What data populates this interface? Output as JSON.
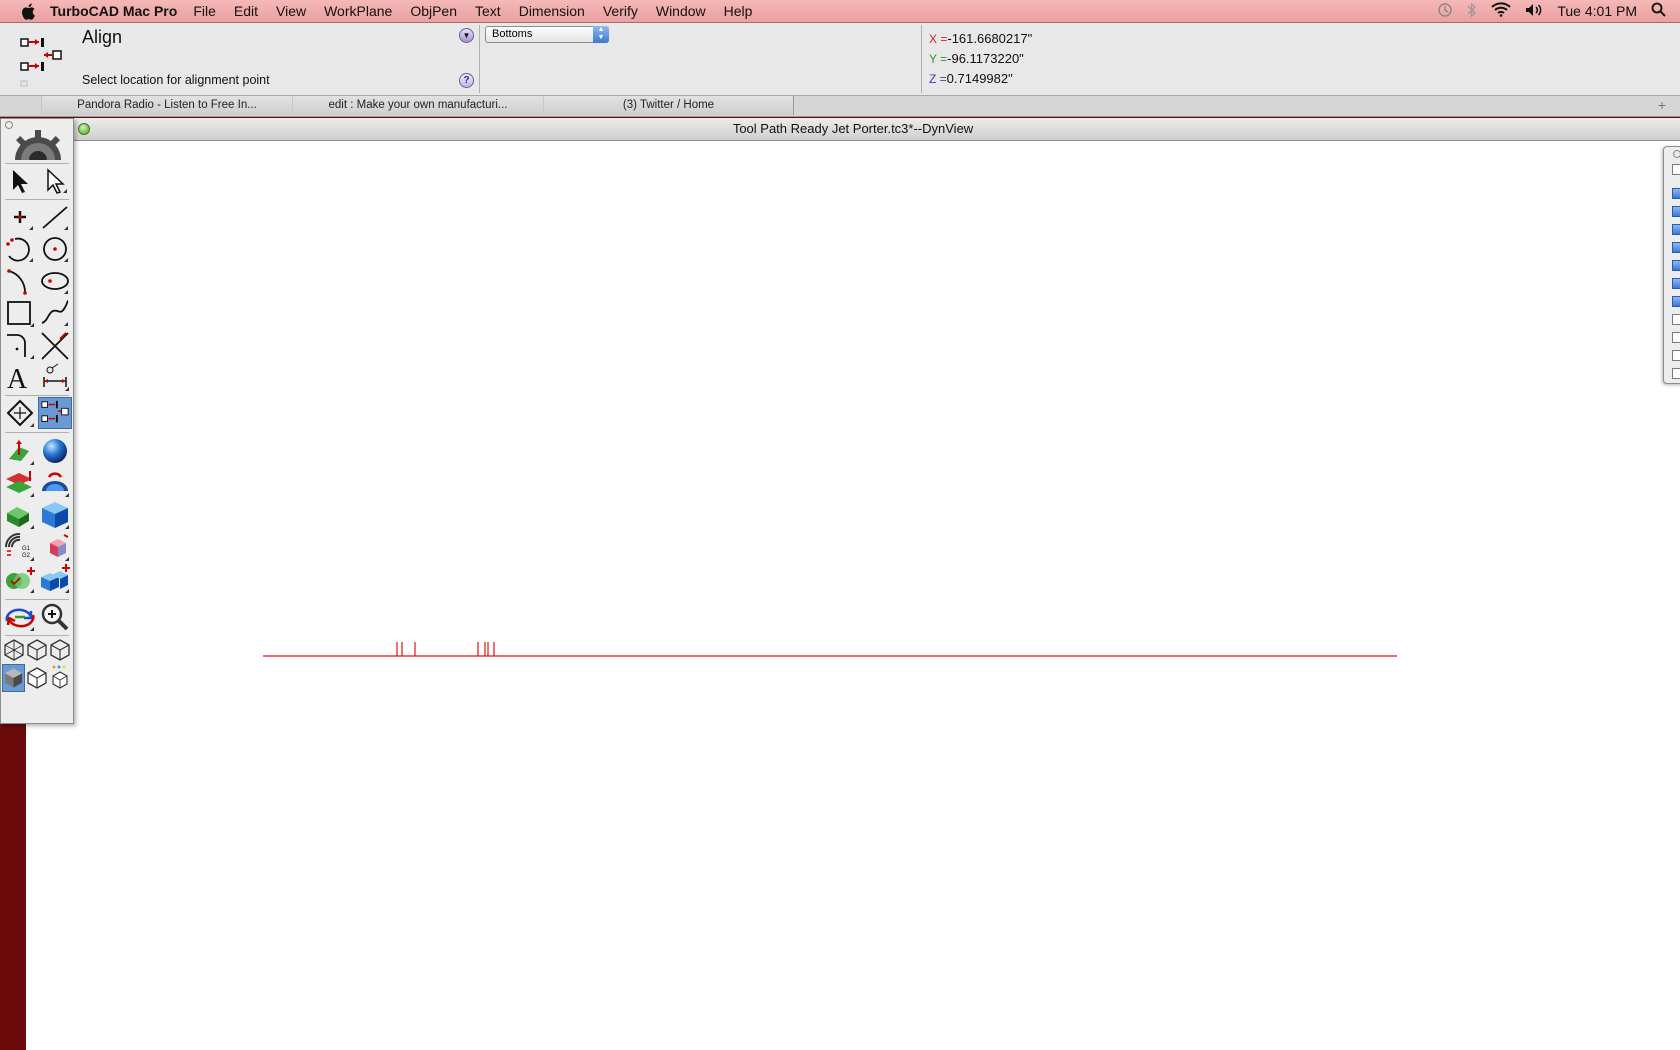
{
  "menubar": {
    "app_name": "TurboCAD Mac Pro",
    "menus": [
      "File",
      "Edit",
      "View",
      "WorkPlane",
      "ObjPen",
      "Text",
      "Dimension",
      "Verify",
      "Window",
      "Help"
    ],
    "clock": "Tue 4:01 PM"
  },
  "inspector": {
    "tool_name": "Align",
    "prompt": "Select location for alignment point",
    "align_option": "Bottoms",
    "coords": {
      "x_label": "X =",
      "x": "-161.6680217\"",
      "y_label": "Y =",
      "y": "-96.1173220\"",
      "z_label": "Z =",
      "z": "0.7149982\""
    },
    "colors": {
      "x": "#e02020",
      "y": "#2a9a2a",
      "z": "#3a3ad0"
    }
  },
  "tabs": [
    {
      "label": "Pandora Radio - Listen to Free In..."
    },
    {
      "label": "edit : Make your own manufacturi..."
    },
    {
      "label": "(3) Twitter / Home"
    }
  ],
  "document": {
    "title": "Tool Path Ready Jet Porter.tc3*--DynView",
    "drawing_color": "#e0101a"
  }
}
